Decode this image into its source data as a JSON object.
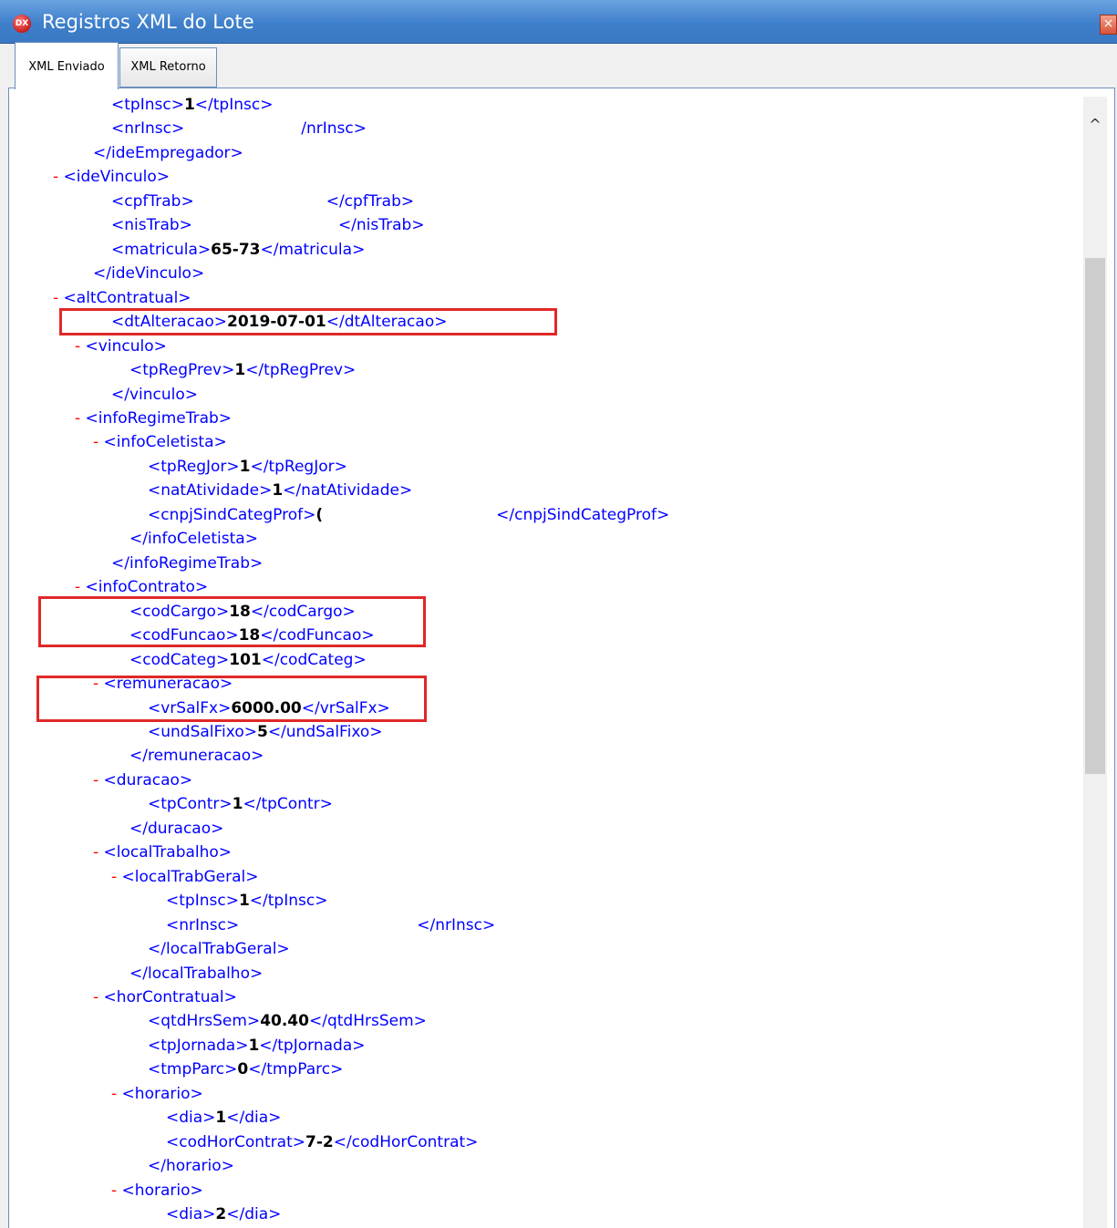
{
  "window": {
    "app_icon_text": "DX",
    "title": "Registros XML do Lote",
    "close_glyph": "×"
  },
  "tabs": [
    {
      "label": "XML Enviado",
      "active": true
    },
    {
      "label": "XML Retorno",
      "active": false
    }
  ],
  "scrollbar": {
    "up_glyph": "^"
  },
  "colors": {
    "tag": "#0000ff",
    "collapse": "#ff0000",
    "value": "#000000",
    "highlight": "#e02828"
  },
  "xml_lines": [
    {
      "prefix": "",
      "open": "<tpInsc>",
      "value": "1",
      "close": "</tpInsc>"
    },
    {
      "prefix": "",
      "open": "<nrInsc>",
      "value": "",
      "close": "/nrInsc>"
    },
    {
      "prefix": "",
      "open": "</ideEmpregador>",
      "value": "",
      "close": ""
    },
    {
      "prefix": "- ",
      "open": "<ideVinculo>",
      "value": "",
      "close": ""
    },
    {
      "prefix": "",
      "open": "<cpfTrab>",
      "value": "",
      "close": "</cpfTrab>"
    },
    {
      "prefix": "",
      "open": "<nisTrab>",
      "value": "",
      "close": "</nisTrab>"
    },
    {
      "prefix": "",
      "open": "<matricula>",
      "value": "65-73",
      "close": "</matricula>"
    },
    {
      "prefix": "",
      "open": "</ideVinculo>",
      "value": "",
      "close": ""
    },
    {
      "prefix": "- ",
      "open": "<altContratual>",
      "value": "",
      "close": ""
    },
    {
      "prefix": "",
      "open": "<dtAlteracao>",
      "value": "2019-07-01",
      "close": "</dtAlteracao>"
    },
    {
      "prefix": "- ",
      "open": "<vinculo>",
      "value": "",
      "close": ""
    },
    {
      "prefix": "",
      "open": "<tpRegPrev>",
      "value": "1",
      "close": "</tpRegPrev>"
    },
    {
      "prefix": "",
      "open": "</vinculo>",
      "value": "",
      "close": ""
    },
    {
      "prefix": "- ",
      "open": "<infoRegimeTrab>",
      "value": "",
      "close": ""
    },
    {
      "prefix": "- ",
      "open": "<infoCeletista>",
      "value": "",
      "close": ""
    },
    {
      "prefix": "",
      "open": "<tpRegJor>",
      "value": "1",
      "close": "</tpRegJor>"
    },
    {
      "prefix": "",
      "open": "<natAtividade>",
      "value": "1",
      "close": "</natAtividade>"
    },
    {
      "prefix": "",
      "open": "<cnpjSindCategProf>",
      "value": "(",
      "close": "</cnpjSindCategProf>"
    },
    {
      "prefix": "",
      "open": "</infoCeletista>",
      "value": "",
      "close": ""
    },
    {
      "prefix": "",
      "open": "</infoRegimeTrab>",
      "value": "",
      "close": ""
    },
    {
      "prefix": "- ",
      "open": "<infoContrato>",
      "value": "",
      "close": ""
    },
    {
      "prefix": "",
      "open": "<codCargo>",
      "value": "18",
      "close": "</codCargo>"
    },
    {
      "prefix": "",
      "open": "<codFuncao>",
      "value": "18",
      "close": "</codFuncao>"
    },
    {
      "prefix": "",
      "open": "<codCateg>",
      "value": "101",
      "close": "</codCateg>"
    },
    {
      "prefix": "- ",
      "open": "<remuneracao>",
      "value": "",
      "close": ""
    },
    {
      "prefix": "",
      "open": "<vrSalFx>",
      "value": "6000.00",
      "close": "</vrSalFx>"
    },
    {
      "prefix": "",
      "open": "<undSalFixo>",
      "value": "5",
      "close": "</undSalFixo>"
    },
    {
      "prefix": "",
      "open": "</remuneracao>",
      "value": "",
      "close": ""
    },
    {
      "prefix": "- ",
      "open": "<duracao>",
      "value": "",
      "close": ""
    },
    {
      "prefix": "",
      "open": "<tpContr>",
      "value": "1",
      "close": "</tpContr>"
    },
    {
      "prefix": "",
      "open": "</duracao>",
      "value": "",
      "close": ""
    },
    {
      "prefix": "- ",
      "open": "<localTrabalho>",
      "value": "",
      "close": ""
    },
    {
      "prefix": "- ",
      "open": "<localTrabGeral>",
      "value": "",
      "close": ""
    },
    {
      "prefix": "",
      "open": "<tpInsc>",
      "value": "1",
      "close": "</tpInsc>"
    },
    {
      "prefix": "",
      "open": "<nrInsc>",
      "value": "",
      "close": "</nrInsc>"
    },
    {
      "prefix": "",
      "open": "</localTrabGeral>",
      "value": "",
      "close": ""
    },
    {
      "prefix": "",
      "open": "</localTrabalho>",
      "value": "",
      "close": ""
    },
    {
      "prefix": "- ",
      "open": "<horContratual>",
      "value": "",
      "close": ""
    },
    {
      "prefix": "",
      "open": "<qtdHrsSem>",
      "value": "40.40",
      "close": "</qtdHrsSem>"
    },
    {
      "prefix": "",
      "open": "<tpJornada>",
      "value": "1",
      "close": "</tpJornada>"
    },
    {
      "prefix": "",
      "open": "<tmpParc>",
      "value": "0",
      "close": "</tmpParc>"
    },
    {
      "prefix": "- ",
      "open": "<horario>",
      "value": "",
      "close": ""
    },
    {
      "prefix": "",
      "open": "<dia>",
      "value": "1",
      "close": "</dia>"
    },
    {
      "prefix": "",
      "open": "<codHorContrat>",
      "value": "7-2",
      "close": "</codHorContrat>"
    },
    {
      "prefix": "",
      "open": "</horario>",
      "value": "",
      "close": ""
    },
    {
      "prefix": "- ",
      "open": "<horario>",
      "value": "",
      "close": ""
    },
    {
      "prefix": "",
      "open": "<dia>",
      "value": "2",
      "close": "</dia>"
    }
  ]
}
